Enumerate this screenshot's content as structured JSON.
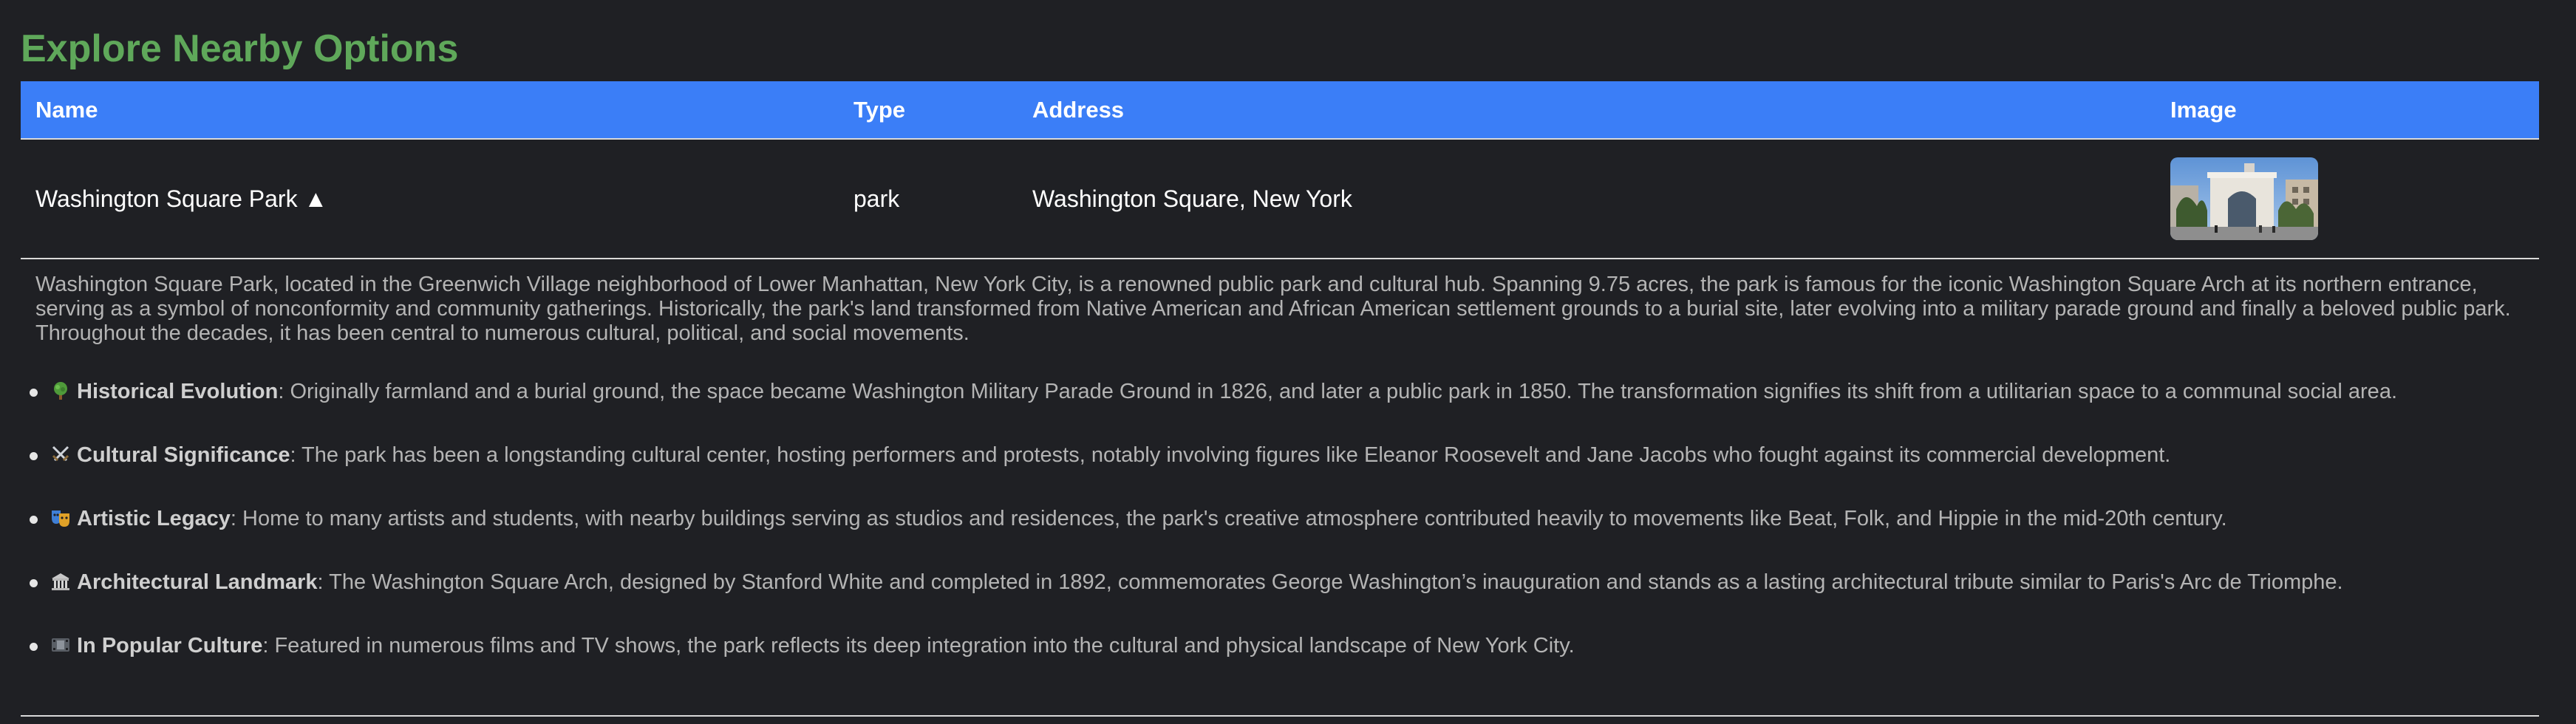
{
  "page": {
    "title": "Explore Nearby Options"
  },
  "table": {
    "headers": {
      "name": "Name",
      "type": "Type",
      "address": "Address",
      "image": "Image"
    },
    "rows": [
      {
        "name": "Washington Square Park ▲",
        "type": "park",
        "address": "Washington Square, New York",
        "image_icon": "park-arch-photo"
      }
    ]
  },
  "details": {
    "summary": "Washington Square Park, located in the Greenwich Village neighborhood of Lower Manhattan, New York City, is a renowned public park and cultural hub. Spanning 9.75 acres, the park is famous for the iconic Washington Square Arch at its northern entrance, serving as a symbol of nonconformity and community gatherings. Historically, the park's land transformed from Native American and African American settlement grounds to a burial site, later evolving into a military parade ground and finally a beloved public park. Throughout the decades, it has been central to numerous cultural, political, and social movements.",
    "facts": [
      {
        "icon": "tree-icon",
        "heading": "Historical Evolution",
        "text": ": Originally farmland and a burial ground, the space became Washington Military Parade Ground in 1826, and later a public park in 1850. The transformation signifies its shift from a utilitarian space to a communal social area."
      },
      {
        "icon": "crossed-swords-icon",
        "heading": "Cultural Significance",
        "text": ": The park has been a longstanding cultural center, hosting performers and protests, notably involving figures like Eleanor Roosevelt and Jane Jacobs who fought against its commercial development."
      },
      {
        "icon": "theater-masks-icon",
        "heading": "Artistic Legacy",
        "text": ": Home to many artists and students, with nearby buildings serving as studios and residences, the park's creative atmosphere contributed heavily to movements like Beat, Folk, and Hippie in the mid-20th century."
      },
      {
        "icon": "classical-building-icon",
        "heading": "Architectural Landmark",
        "text": ": The Washington Square Arch, designed by Stanford White and completed in 1892, commemorates George Washington’s inauguration and stands as a lasting architectural tribute similar to Paris's Arc de Triomphe."
      },
      {
        "icon": "film-frames-icon",
        "heading": "In Popular Culture",
        "text": ": Featured in numerous films and TV shows, the park reflects its deep integration into the cultural and physical landscape of New York City."
      }
    ]
  },
  "colors": {
    "background": "#1f2024",
    "title": "#5fa85a",
    "header_bg": "#3b7ef7",
    "body_text": "#b4b4b4"
  }
}
